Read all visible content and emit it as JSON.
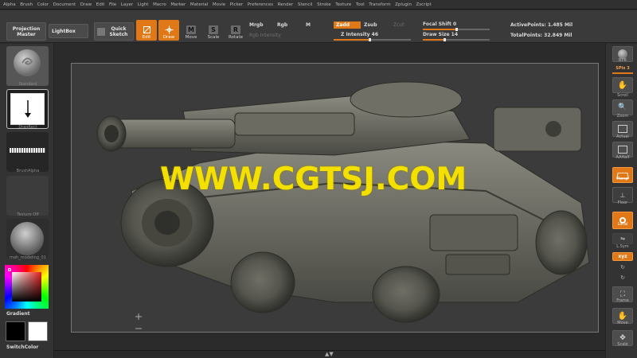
{
  "menu": [
    "Alpha",
    "Brush",
    "Color",
    "Document",
    "Draw",
    "Edit",
    "File",
    "Layer",
    "Light",
    "Macro",
    "Marker",
    "Material",
    "Movie",
    "Picker",
    "Preferences",
    "Render",
    "Stencil",
    "Stroke",
    "Texture",
    "Tool",
    "Transform",
    "Zplugin",
    "Zscript"
  ],
  "shelf": {
    "projection_master": "Projection Master",
    "lightbox": "LightBox",
    "quick_sketch": "Quick Sketch",
    "tools": {
      "edit": "Edit",
      "draw": "Draw",
      "move": "Move",
      "scale": "Scale",
      "rotate": "Rotate"
    },
    "glyphs": {
      "move": "M",
      "scale": "S",
      "rotate": "R"
    },
    "mrgb": "Mrgb",
    "rgb": "Rgb",
    "m": "M",
    "rgb_intensity": "Rgb Intensity",
    "zadd": "Zadd",
    "zsub": "Zsub",
    "zcut": "Zcut",
    "z_intensity": "Z Intensity 46",
    "focal_shift": "Focal Shift 0",
    "draw_size": "Draw Size 14",
    "active_points": "ActivePoints: 1.485 Mil",
    "total_points": "TotalPoints: 32.849 Mil",
    "z_intensity_value": 46,
    "focal_shift_value": 0,
    "draw_size_value": 14
  },
  "left": {
    "material_label": "Standard",
    "stroke_label": "DragRect",
    "alpha_label": "BrushAlpha",
    "texture_label": "Texture Off",
    "matcap_label": "mah_modeling_01",
    "gradient_label": "Gradient",
    "switchcolor_label": "SwitchColor"
  },
  "viewport": {
    "watermark": "WWW.CGTSJ.COM"
  },
  "right": {
    "bpr": "BPR",
    "spix": "SPix 3",
    "scroll": "Scroll",
    "zoom": "Zoom",
    "actual": "Actual",
    "aahalf": "AAHalf",
    "persp": "Persp",
    "floor": "Floor",
    "local": "Local",
    "lsym": "L.Sym",
    "xyz": "xyz",
    "frame": "Frame",
    "move": "Move",
    "scale": "Scale"
  },
  "colors": {
    "accent": "#e07818",
    "watermark": "#f3e000",
    "viewport_bg": "#3b3b3b"
  }
}
